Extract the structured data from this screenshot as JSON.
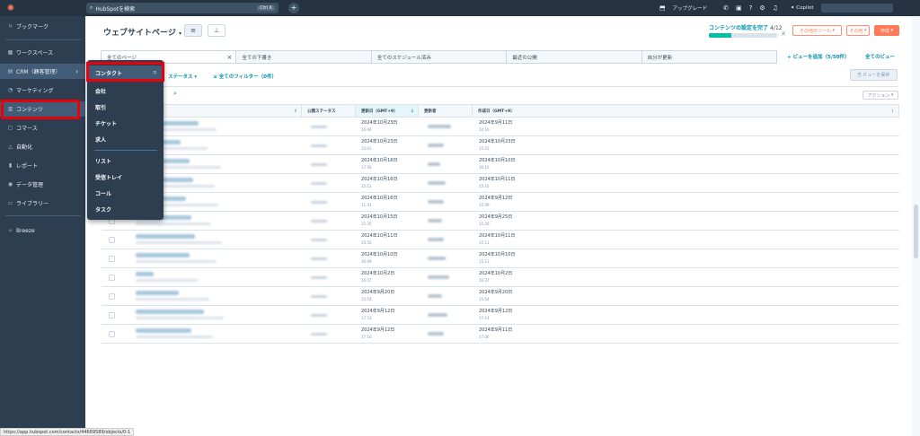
{
  "topbar": {
    "search_placeholder": "HubSpotを検索",
    "search_shortcut": "Ctrl K",
    "plus_icon": "plus-icon",
    "upgrade_label": "アップグレード",
    "copilot_label": "Copilot"
  },
  "sidebar": {
    "items": [
      {
        "label": "ブックマーク",
        "icon": "bookmark-icon"
      },
      {
        "label": "ワークスペース",
        "icon": "workspace-icon"
      },
      {
        "label": "CRM（顧客管理）",
        "icon": "crm-icon"
      },
      {
        "label": "マーケティング",
        "icon": "marketing-icon"
      },
      {
        "label": "コンテンツ",
        "icon": "content-icon"
      },
      {
        "label": "コマース",
        "icon": "commerce-icon"
      },
      {
        "label": "自動化",
        "icon": "automation-icon"
      },
      {
        "label": "レポート",
        "icon": "report-icon"
      },
      {
        "label": "データ管理",
        "icon": "data-icon"
      },
      {
        "label": "ライブラリー",
        "icon": "library-icon"
      },
      {
        "label": "Breeze",
        "icon": "breeze-icon"
      }
    ]
  },
  "flyout": {
    "items": [
      "コンタクト",
      "会社",
      "取引",
      "チケット",
      "求人",
      "リスト",
      "受信トレイ",
      "コール",
      "タスク"
    ]
  },
  "header": {
    "title": "ウェブサイトページ",
    "setup_label": "コンテンツの設定を完了",
    "setup_count": "4/12",
    "setup_progress": 0.33,
    "tools_button": "その他のツール",
    "more_button": "その他",
    "create_button": "作成"
  },
  "tabs": [
    {
      "label": "全てのページ",
      "active": true
    },
    {
      "label": "全ての下書き",
      "active": false
    },
    {
      "label": "全てのスケジュール済み",
      "active": false
    },
    {
      "label": "最近の公開",
      "active": false
    },
    {
      "label": "自分が更新",
      "active": false
    }
  ],
  "tab_actions": {
    "add_view": "ビューを追加（5/50件）",
    "all_views": "全てのビュー"
  },
  "filters": {
    "status_filter": "ステータス",
    "all_filters": "全てのフィルター（0件）",
    "save_view": "ビューを保存",
    "actions": "アクション"
  },
  "table": {
    "headers": [
      "公開ステータス",
      "更新日（GMT+9）",
      "更新者",
      "作成日（GMT+9）"
    ],
    "rows": [
      {
        "updated": "2024年10月23日",
        "updated_time": "16:44",
        "created": "2024年9月11日",
        "created_time": "14:16"
      },
      {
        "updated": "2024年10月23日",
        "updated_time": "15:01",
        "created": "2024年10月23日",
        "created_time": "15:03"
      },
      {
        "updated": "2024年10月16日",
        "updated_time": "17:56",
        "created": "2024年10月10日",
        "created_time": "16:16"
      },
      {
        "updated": "2024年10月16日",
        "updated_time": "15:12",
        "created": "2024年10月11日",
        "created_time": "15:16"
      },
      {
        "updated": "2024年10月16日",
        "updated_time": "11:41",
        "created": "2024年9月12日",
        "created_time": "15:09"
      },
      {
        "updated": "2024年10月15日",
        "updated_time": "15:35",
        "created": "2024年9月25日",
        "created_time": "15:26"
      },
      {
        "updated": "2024年10月11日",
        "updated_time": "15:55",
        "created": "2024年10月11日",
        "created_time": "15:11"
      },
      {
        "updated": "2024年10月10日",
        "updated_time": "16:09",
        "created": "2024年10月10日",
        "created_time": "15:13"
      },
      {
        "updated": "2024年10月2日",
        "updated_time": "16:37",
        "created": "2024年10月2日",
        "created_time": "16:37"
      },
      {
        "updated": "2024年9月20日",
        "updated_time": "15:54",
        "created": "2024年9月20日",
        "created_time": "15:54"
      },
      {
        "updated": "2024年9月12日",
        "updated_time": "17:53",
        "created": "2024年9月12日",
        "created_time": "17:14"
      },
      {
        "updated": "2024年9月12日",
        "updated_time": "17:10",
        "created": "2024年9月11日",
        "created_time": "17:06"
      }
    ]
  },
  "statusbar": {
    "url": "https://app.hubspot.com/contacts/44669589/objects/0-1"
  },
  "colors": {
    "sidebar_bg": "#2d3e50",
    "topbar_bg": "#253342",
    "accent": "#ff7a59",
    "link": "#0091ae",
    "highlight": "#e8000b"
  }
}
